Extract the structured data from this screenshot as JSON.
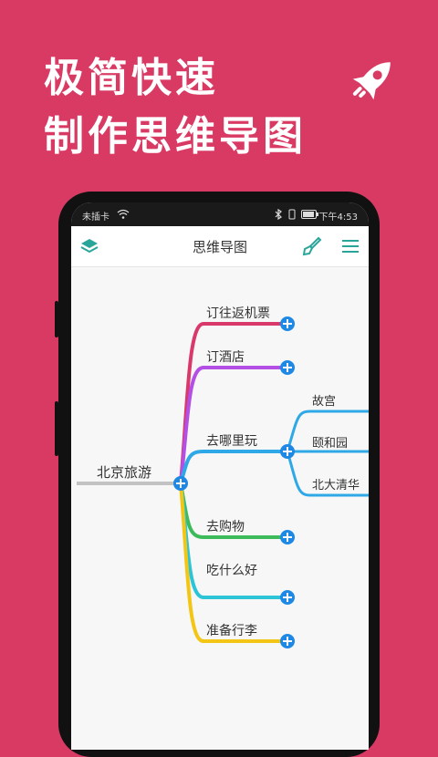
{
  "promo": {
    "line1": "极简快速",
    "line2": "制作思维导图"
  },
  "status": {
    "carrier": "未插卡",
    "time": "下午4:53"
  },
  "appbar": {
    "title": "思维导图"
  },
  "mindmap": {
    "root": "北京旅游",
    "branches": [
      {
        "label": "订往返机票",
        "color": "#d9386a"
      },
      {
        "label": "订酒店",
        "color": "#b44fe6"
      },
      {
        "label": "去哪里玩",
        "color": "#2ea8e6",
        "children": [
          "故宫",
          "颐和园",
          "北大清华"
        ]
      },
      {
        "label": "去购物",
        "color": "#3dbb5a"
      },
      {
        "label": "吃什么好",
        "color": "#2ec4d8"
      },
      {
        "label": "准备行李",
        "color": "#f3c514"
      }
    ]
  },
  "icons": {
    "rocket": "rocket-icon",
    "layers": "layers-icon",
    "brush": "brush-icon",
    "menu": "menu-icon",
    "add": "add-node-icon",
    "zoom": "add-view-icon"
  }
}
